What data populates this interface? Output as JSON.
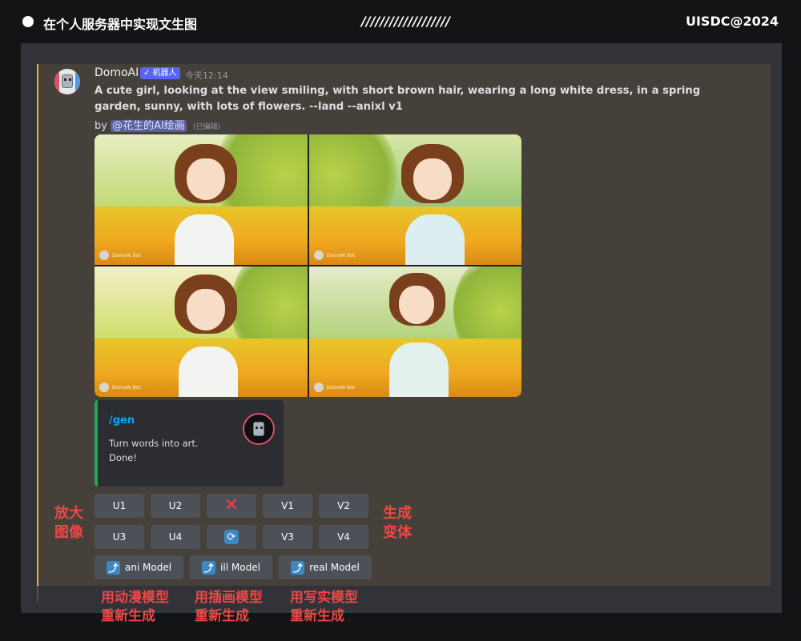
{
  "header": {
    "title": "在个人服务器中实现文生图",
    "slashes": "///////////////////",
    "brand": "UISDC@2024"
  },
  "message": {
    "username": "DomoAI",
    "bot_badge": "✓ 机器人",
    "timestamp": "今天12:14",
    "prompt": "A cute girl, looking at the view smiling, with short brown hair, wearing a long white dress, in a spring garden, sunny, with lots of flowers. --land --anixl v1",
    "by": "by",
    "mention": "@花生的AI绘画",
    "edited": "(已编辑)",
    "watermark": "DomoAI Bot"
  },
  "embed": {
    "title": "/gen",
    "line1": "Turn words into art.",
    "line2": "Done!"
  },
  "buttons": {
    "u1": "U1",
    "u2": "U2",
    "v1": "V1",
    "v2": "V2",
    "u3": "U3",
    "u4": "U4",
    "v3": "V3",
    "v4": "V4",
    "ani": "ani Model",
    "ill": "ill Model",
    "real": "real Model"
  },
  "notes": {
    "upscale_1": "放大",
    "upscale_2": "图像",
    "variant_1": "生成",
    "variant_2": "变体",
    "ani_1": "用动漫模型",
    "ani_2": "重新生成",
    "ill_1": "用插画模型",
    "ill_2": "重新生成",
    "real_1": "用写实模型",
    "real_2": "重新生成"
  },
  "colors": {
    "accent_bar": "#f0b232",
    "bot_badge": "#5865f2",
    "embed_border": "#23a55a",
    "embed_title": "#00a8fc",
    "button": "#4e5058",
    "annotation": "#f04646"
  }
}
